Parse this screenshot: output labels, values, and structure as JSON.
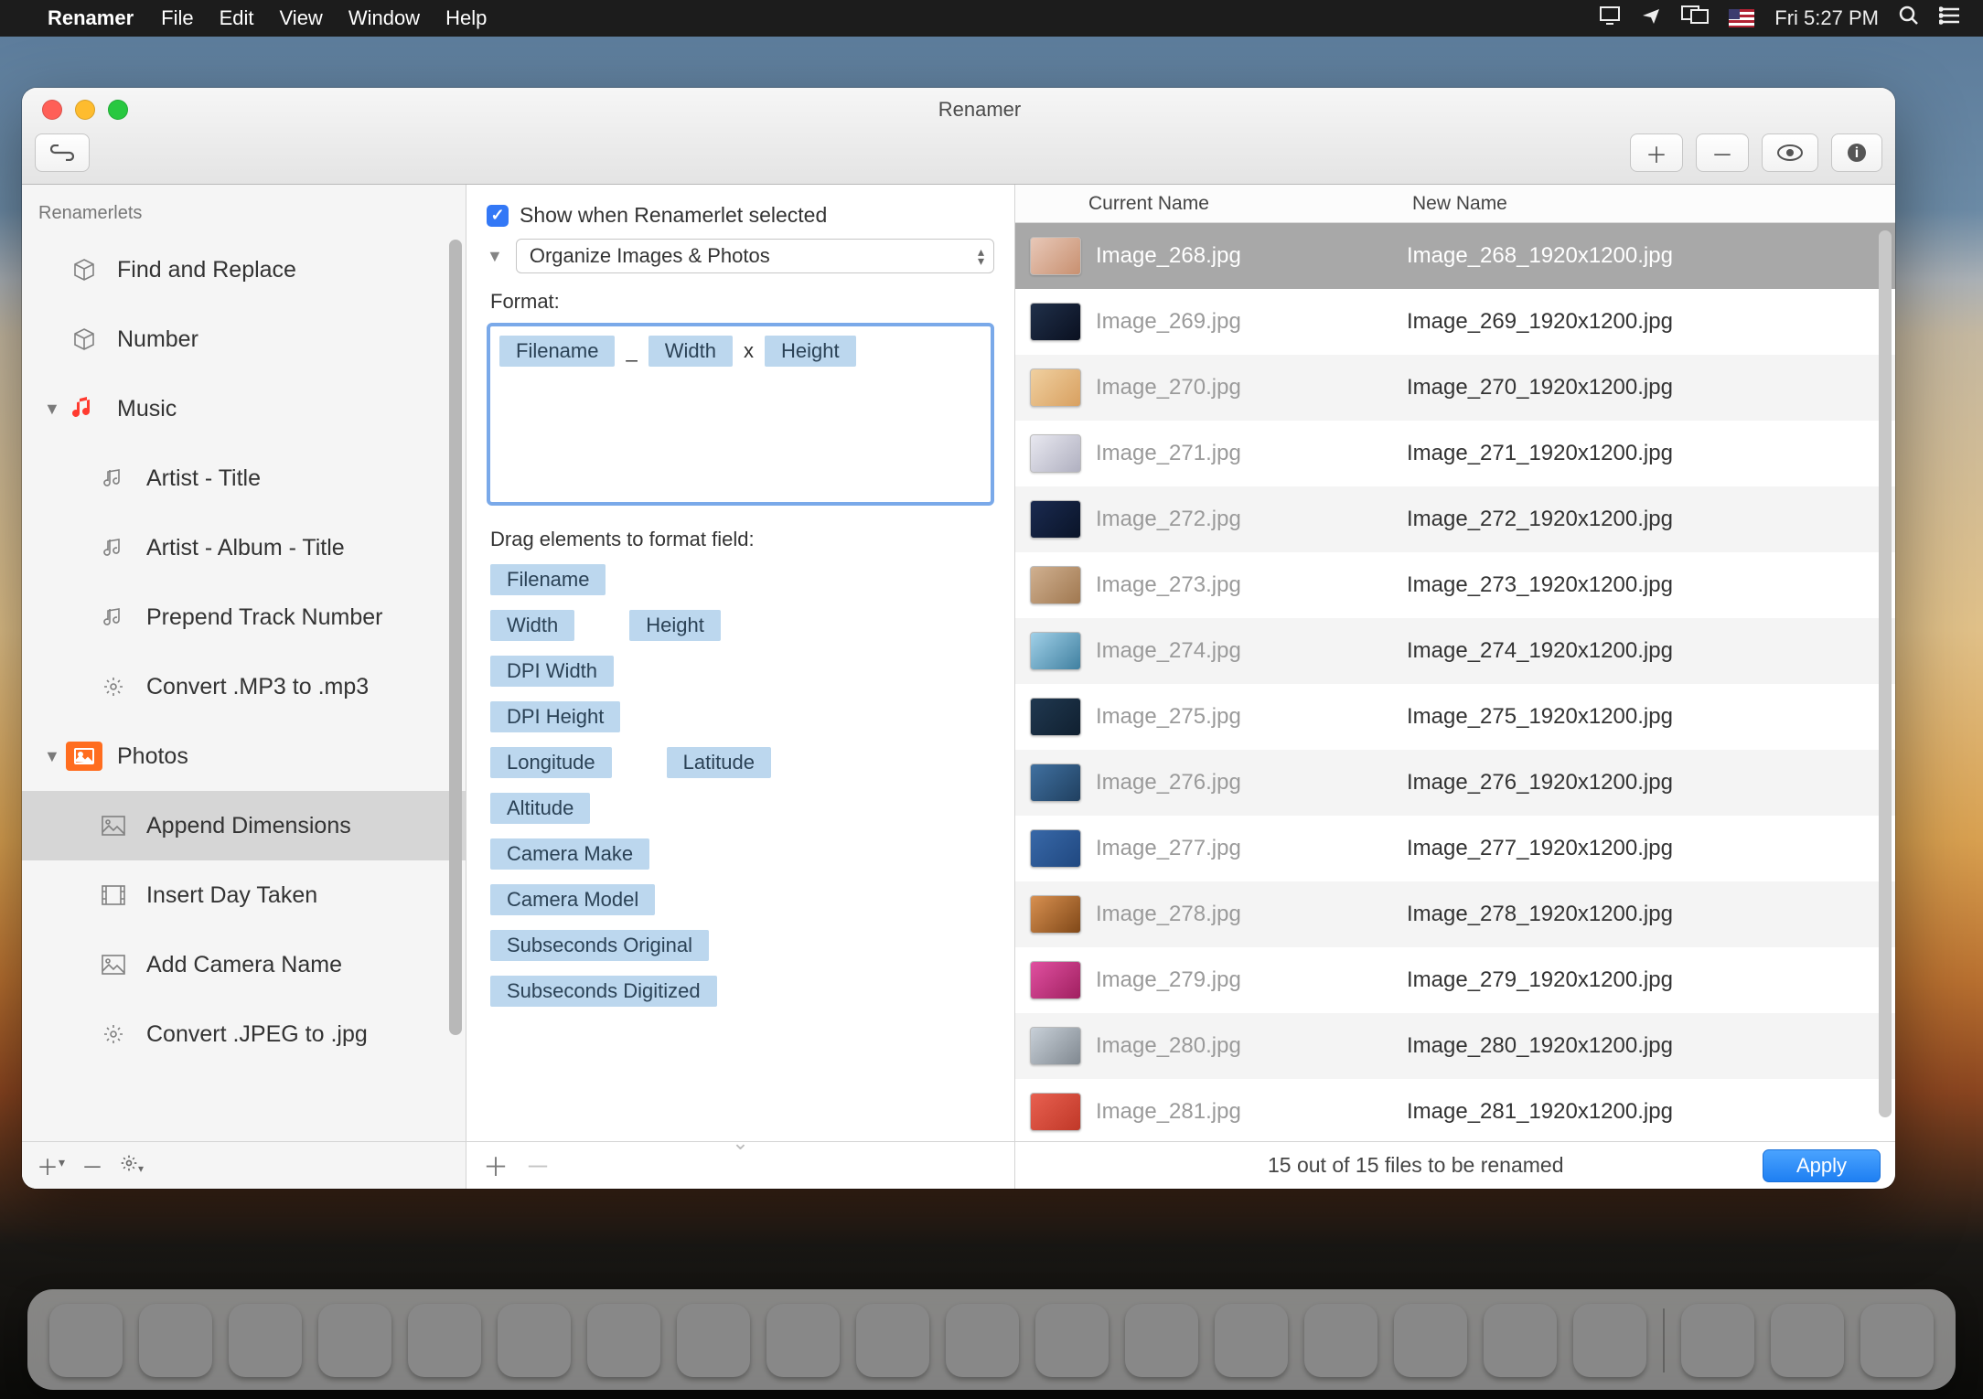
{
  "menubar": {
    "app": "Renamer",
    "items": [
      "File",
      "Edit",
      "View",
      "Window",
      "Help"
    ],
    "clock": "Fri 5:27 PM"
  },
  "window": {
    "title": "Renamer"
  },
  "sidebar": {
    "header": "Renamerlets",
    "items": [
      {
        "label": "Find and Replace",
        "icon": "cube"
      },
      {
        "label": "Number",
        "icon": "cube"
      }
    ],
    "music": {
      "label": "Music",
      "items": [
        {
          "label": "Artist - Title",
          "icon": "note"
        },
        {
          "label": "Artist - Album - Title",
          "icon": "note"
        },
        {
          "label": "Prepend Track Number",
          "icon": "note"
        },
        {
          "label": "Convert .MP3 to .mp3",
          "icon": "gear"
        }
      ]
    },
    "photos": {
      "label": "Photos",
      "items": [
        {
          "label": "Append Dimensions",
          "icon": "image",
          "selected": true
        },
        {
          "label": "Insert Day Taken",
          "icon": "film"
        },
        {
          "label": "Add Camera Name",
          "icon": "image"
        },
        {
          "label": "Convert .JPEG to .jpg",
          "icon": "gear"
        }
      ]
    }
  },
  "middle": {
    "show_label": "Show when Renamerlet selected",
    "preset": "Organize Images & Photos",
    "format_label": "Format:",
    "format_tokens": [
      "Filename",
      "_",
      "Width",
      "x",
      "Height"
    ],
    "drag_label": "Drag elements to format field:",
    "available_tokens": [
      [
        "Filename"
      ],
      [
        "Width",
        "Height"
      ],
      [
        "DPI Width"
      ],
      [
        "DPI Height"
      ],
      [
        "Longitude",
        "Latitude"
      ],
      [
        "Altitude"
      ],
      [
        "Camera Make"
      ],
      [
        "Camera Model"
      ],
      [
        "Subseconds Original"
      ],
      [
        "Subseconds Digitized"
      ]
    ]
  },
  "right": {
    "col_current": "Current Name",
    "col_new": "New Name",
    "rows": [
      {
        "current": "Image_268.jpg",
        "new": "Image_268_1920x1200.jpg",
        "selected": true
      },
      {
        "current": "Image_269.jpg",
        "new": "Image_269_1920x1200.jpg"
      },
      {
        "current": "Image_270.jpg",
        "new": "Image_270_1920x1200.jpg"
      },
      {
        "current": "Image_271.jpg",
        "new": "Image_271_1920x1200.jpg"
      },
      {
        "current": "Image_272.jpg",
        "new": "Image_272_1920x1200.jpg"
      },
      {
        "current": "Image_273.jpg",
        "new": "Image_273_1920x1200.jpg"
      },
      {
        "current": "Image_274.jpg",
        "new": "Image_274_1920x1200.jpg"
      },
      {
        "current": "Image_275.jpg",
        "new": "Image_275_1920x1200.jpg"
      },
      {
        "current": "Image_276.jpg",
        "new": "Image_276_1920x1200.jpg"
      },
      {
        "current": "Image_277.jpg",
        "new": "Image_277_1920x1200.jpg"
      },
      {
        "current": "Image_278.jpg",
        "new": "Image_278_1920x1200.jpg"
      },
      {
        "current": "Image_279.jpg",
        "new": "Image_279_1920x1200.jpg"
      },
      {
        "current": "Image_280.jpg",
        "new": "Image_280_1920x1200.jpg"
      },
      {
        "current": "Image_281.jpg",
        "new": "Image_281_1920x1200.jpg"
      }
    ],
    "status": "15 out of 15 files to be renamed",
    "apply": "Apply"
  }
}
